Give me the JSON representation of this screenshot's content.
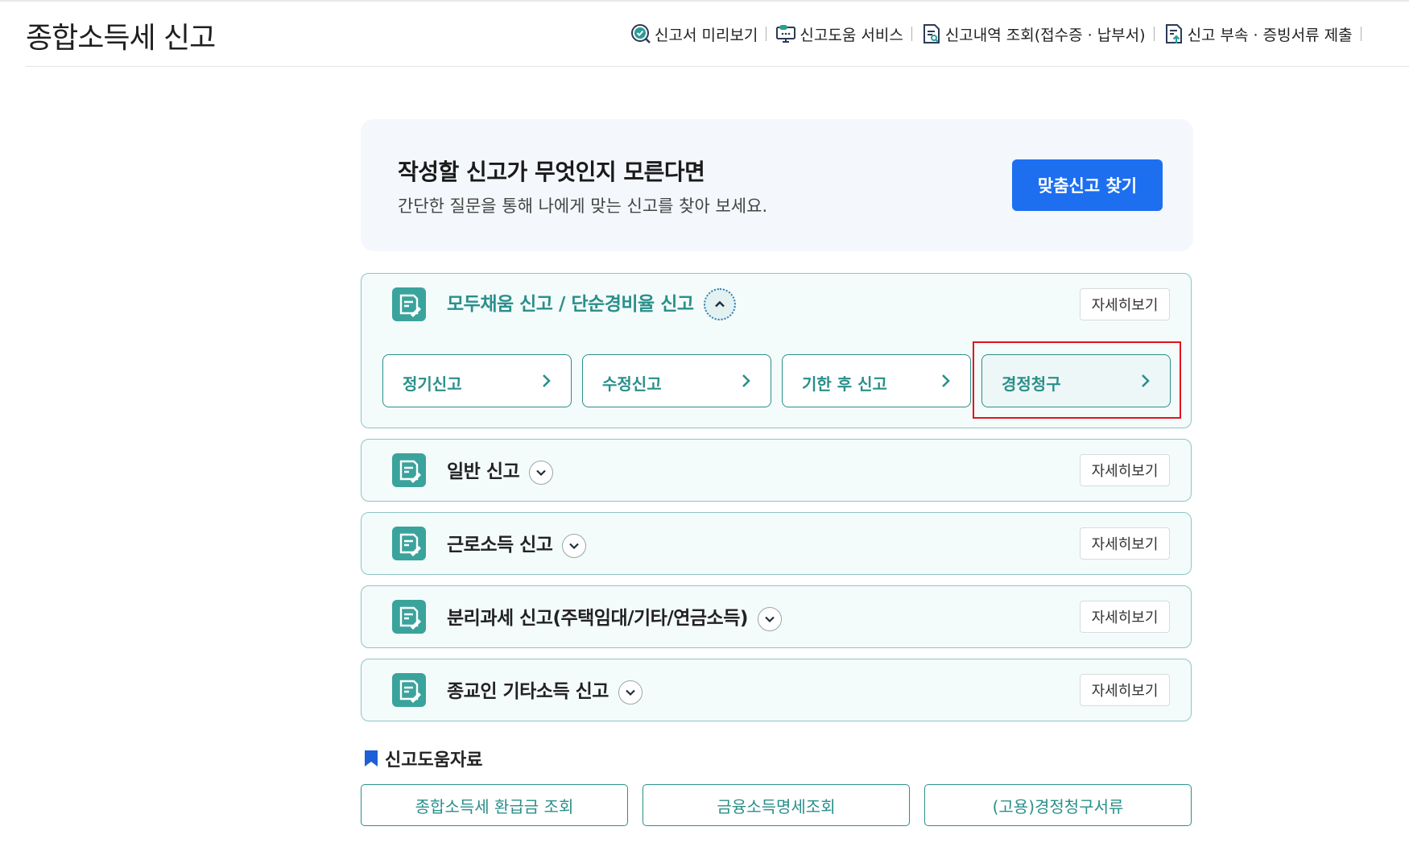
{
  "page": {
    "title": "종합소득세 신고"
  },
  "topnav": {
    "items": [
      {
        "label": "신고서 미리보기"
      },
      {
        "label": "신고도움 서비스"
      },
      {
        "label": "신고내역 조회(접수증 · 납부서)"
      },
      {
        "label": "신고 부속 · 증빙서류 제출"
      }
    ]
  },
  "promo": {
    "title": "작성할 신고가 무엇인지 모른다면",
    "desc": "간단한 질문을 통해 나에게 맞는 신고를 찾아 보세요.",
    "button": "맞춤신고 찾기"
  },
  "sections": [
    {
      "title": "모두채움 신고 / 단순경비율 신고",
      "detail": "자세히보기",
      "expanded": true,
      "sub": [
        "정기신고",
        "수정신고",
        "기한 후 신고",
        "경정청구"
      ]
    },
    {
      "title": "일반 신고",
      "detail": "자세히보기"
    },
    {
      "title": "근로소득 신고",
      "detail": "자세히보기"
    },
    {
      "title": "분리과세 신고(주택임대/기타/연금소득)",
      "detail": "자세히보기"
    },
    {
      "title": "종교인 기타소득 신고",
      "detail": "자세히보기"
    }
  ],
  "resources": {
    "title": "신고도움자료",
    "buttons": [
      "종합소득세 환급금 조회",
      "금융소득명세조회",
      "(고용)경정청구서류"
    ]
  },
  "colors": {
    "teal": "#2a8f8a",
    "primary": "#1d6ff0",
    "highlight": "#e0141e"
  },
  "icons": [
    "check-search-icon",
    "monitor-chat-icon",
    "document-search-icon",
    "document-upload-icon",
    "document-edit-icon",
    "chevron-up-icon",
    "chevron-down-icon",
    "chevron-right-icon",
    "bookmark-icon"
  ]
}
